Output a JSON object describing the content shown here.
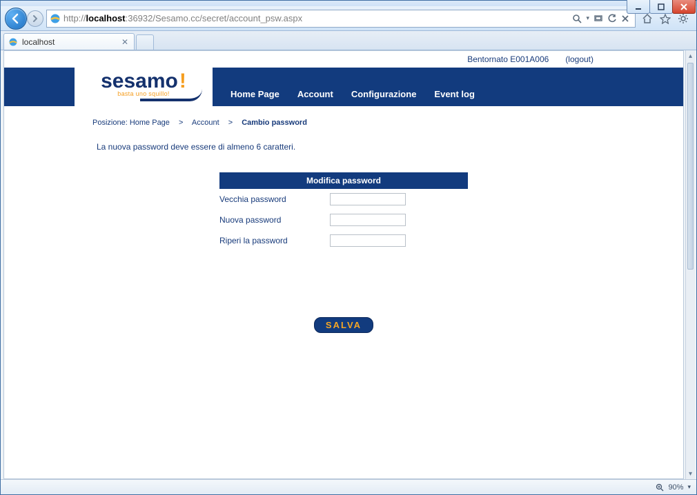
{
  "window": {
    "url_prefix": "http://",
    "url_bold": "localhost",
    "url_suffix": ":36932/Sesamo.cc/secret/account_psw.aspx",
    "tab_title": "localhost",
    "zoom": "90%"
  },
  "welcome": {
    "greeting": "Bentornato E001A006",
    "logout": "(logout)"
  },
  "logo": {
    "text": "sesamo",
    "exclaim": "!",
    "tagline": "basta uno squillo!"
  },
  "nav": {
    "home": "Home Page",
    "account": "Account",
    "config": "Configurazione",
    "eventlog": "Event log"
  },
  "breadcrumb": {
    "label": "Posizione:",
    "home": "Home Page",
    "sep": ">",
    "account": "Account",
    "current": "Cambio password"
  },
  "page": {
    "info": "La nuova password deve essere di almeno 6 caratteri.",
    "form_title": "Modifica password",
    "old_pw": "Vecchia password",
    "new_pw": "Nuova password",
    "repeat_pw": "Riperi la password",
    "save": "SALVA"
  }
}
